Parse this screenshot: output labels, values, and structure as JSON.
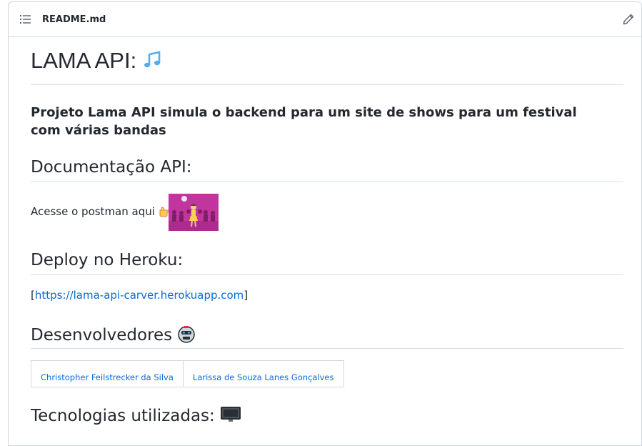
{
  "header": {
    "file_name": "README.md",
    "toc_icon": "list-icon",
    "edit_icon": "pencil-icon"
  },
  "readme": {
    "title": "LAMA API:",
    "title_icon": "musical-notes-icon",
    "subtitle": "Projeto Lama API simula o backend para um site de shows para um festival com várias bandas",
    "sections": {
      "docs": {
        "heading": "Documentação API:",
        "text": "Acesse o postman aqui",
        "pointer_icon": "pointing-hand-icon",
        "gif_icon": "dancing-party-gif-icon"
      },
      "deploy": {
        "heading": "Deploy no Heroku:",
        "bracket_open": "[",
        "link": "https://lama-api-carver.herokuapp.com",
        "bracket_close": "]"
      },
      "devs": {
        "heading": "Desenvolvedores",
        "heading_icon": "robot-face-icon",
        "people": [
          "Christopher Feilstrecker da Silva",
          "Larissa de Souza Lanes Gonçalves"
        ]
      },
      "tech": {
        "heading": "Tecnologias utilizadas:",
        "heading_icon": "computer-monitor-icon"
      }
    }
  },
  "colors": {
    "link": "#0969da",
    "text": "#24292f",
    "border": "#d0d7de",
    "gif_background": "#c2359f"
  }
}
